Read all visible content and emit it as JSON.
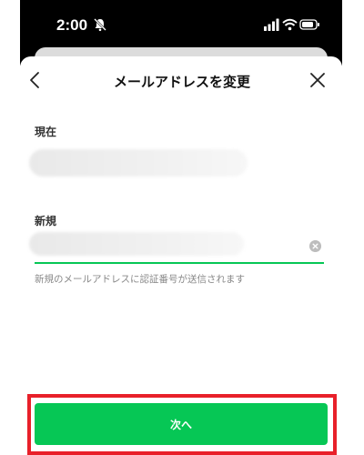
{
  "status_bar": {
    "time": "2:00",
    "silent_icon": "bell-slash-icon",
    "signal_icon": "cellular-signal-icon",
    "wifi_icon": "wifi-icon",
    "battery_icon": "battery-icon"
  },
  "nav": {
    "title": "メールアドレスを変更",
    "back_icon": "chevron-left-icon",
    "close_icon": "close-icon"
  },
  "form": {
    "current_label": "現在",
    "current_value": "",
    "new_label": "新規",
    "new_value": "",
    "new_placeholder": "",
    "clear_icon": "clear-circle-icon",
    "hint": "新規のメールアドレスに認証番号が送信されます"
  },
  "footer": {
    "next_label": "次へ"
  },
  "colors": {
    "accent": "#06c755",
    "highlight": "#e8202a",
    "text": "#111111",
    "hint_text": "#888888"
  }
}
